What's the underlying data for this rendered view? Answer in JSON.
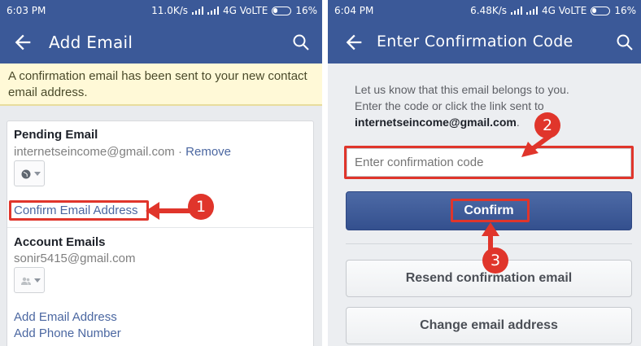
{
  "left": {
    "status": {
      "time": "6:03 PM",
      "speed": "11.0K/s",
      "network": "4G VoLTE",
      "battery": "16%"
    },
    "title": "Add Email",
    "notice": "A confirmation email has been sent to your new contact email address.",
    "pending": {
      "heading": "Pending Email",
      "email": "internetseincome@gmail.com",
      "separator": " · ",
      "remove": "Remove",
      "confirm_link": "Confirm Email Address"
    },
    "account": {
      "heading": "Account Emails",
      "email": "sonir5415@gmail.com",
      "add_email": "Add Email Address",
      "add_phone": "Add Phone Number"
    },
    "badge": "1"
  },
  "right": {
    "status": {
      "time": "6:04 PM",
      "speed": "6.48K/s",
      "network": "4G VoLTE",
      "battery": "16%"
    },
    "title": "Enter Confirmation Code",
    "line1": "Let us know that this email belongs to you.",
    "line2": "Enter the code or click the link sent to",
    "email": "internetseincome@gmail.com",
    "period": ".",
    "placeholder": "Enter confirmation code",
    "confirm": "Confirm",
    "resend": "Resend confirmation email",
    "change": "Change email address",
    "badge2": "2",
    "badge3": "3"
  },
  "colors": {
    "brand": "#3b5998",
    "annotation": "#e0352b",
    "notice": "#fff9d7",
    "link": "#4b67a1"
  },
  "icons": [
    "back-arrow-icon",
    "search-icon",
    "globe-icon",
    "friends-icon",
    "chevron-down-icon",
    "signal-icon",
    "battery-icon"
  ]
}
